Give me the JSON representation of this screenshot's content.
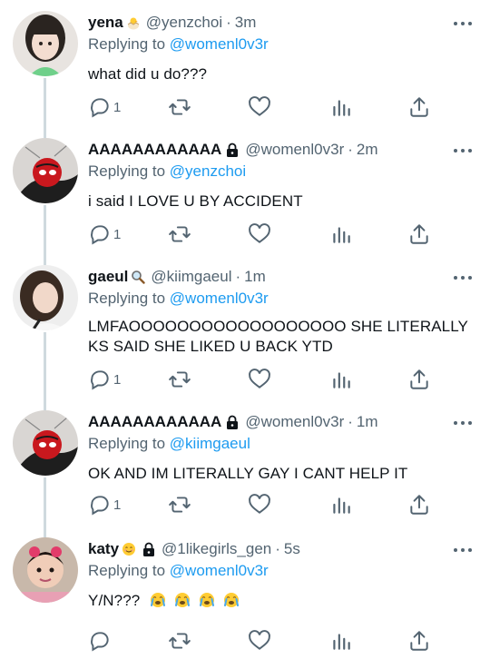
{
  "tweets": [
    {
      "name": "yena",
      "handle": "@yenzchoi",
      "time": "3m",
      "replying_prefix": "Replying to",
      "replying_to": "@womenl0v3r",
      "text": "what did u do???",
      "reply_count": "1"
    },
    {
      "name": "AAAAAAAAAAAA",
      "handle": "@womenl0v3r",
      "time": "2m",
      "replying_prefix": "Replying to",
      "replying_to": "@yenzchoi",
      "text": "i said I LOVE U BY ACCIDENT",
      "reply_count": "1"
    },
    {
      "name": "gaeul",
      "handle": "@kiimgaeul",
      "time": "1m",
      "replying_prefix": "Replying to",
      "replying_to": "@womenl0v3r",
      "text_line1": "LMFAOOOOOOOOOOOOOOOOOO SHE LITERALLY",
      "text_line2": "KS SAID SHE LIKED U BACK YTD",
      "reply_count": "1"
    },
    {
      "name": "AAAAAAAAAAAA",
      "handle": "@womenl0v3r",
      "time": "1m",
      "replying_prefix": "Replying to",
      "replying_to": "@kiimgaeul",
      "text": "OK AND IM LITERALLY GAY I CANT HELP IT",
      "reply_count": "1"
    },
    {
      "name": "katy",
      "handle": "@1likegirls_gen",
      "time": "5s",
      "replying_prefix": "Replying to",
      "replying_to": "@womenl0v3r",
      "text": "Y/N???",
      "reply_count": ""
    }
  ],
  "separator": "·",
  "colors": {
    "mention": "#1d9bf0",
    "muted": "#536471",
    "thread_line": "#cfd9de"
  },
  "icons": [
    "reply-icon",
    "retweet-icon",
    "like-icon",
    "views-icon",
    "share-icon",
    "lock-icon",
    "more-icon",
    "crying-emoji",
    "hatching-chick-emoji",
    "magnifier-emoji",
    "smiling-emoji"
  ]
}
